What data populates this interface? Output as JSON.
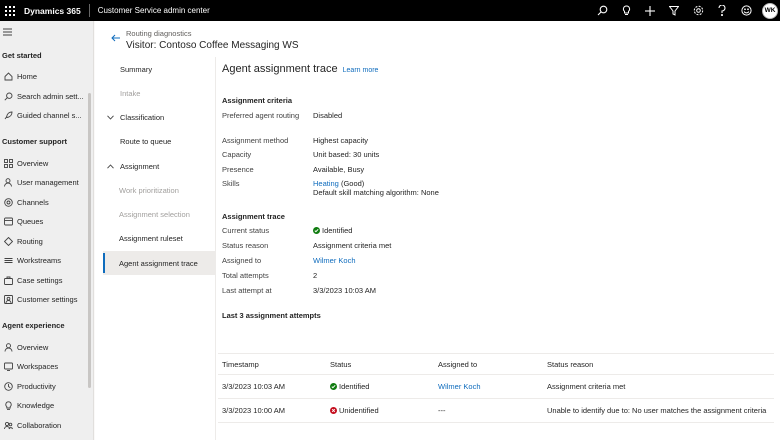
{
  "topbar": {
    "brand": "Dynamics 365",
    "app_name": "Customer Service admin center",
    "avatar_initials": "WK",
    "icons": [
      "search-icon",
      "lightbulb-icon",
      "plus-icon",
      "filter-icon",
      "gear-icon",
      "help-icon",
      "smiley-icon"
    ]
  },
  "leftnav": {
    "sections": [
      {
        "title": "Get started",
        "items": [
          {
            "label": "Home",
            "icon": "home-icon"
          },
          {
            "label": "Search admin sett...",
            "icon": "search-icon"
          },
          {
            "label": "Guided channel s...",
            "icon": "rocket-icon"
          }
        ]
      },
      {
        "title": "Customer support",
        "items": [
          {
            "label": "Overview",
            "icon": "grid-icon"
          },
          {
            "label": "User management",
            "icon": "user-icon"
          },
          {
            "label": "Channels",
            "icon": "channels-icon"
          },
          {
            "label": "Queues",
            "icon": "queue-icon"
          },
          {
            "label": "Routing",
            "icon": "routing-icon"
          },
          {
            "label": "Workstreams",
            "icon": "workstream-icon"
          },
          {
            "label": "Case settings",
            "icon": "case-icon"
          },
          {
            "label": "Customer settings",
            "icon": "customer-icon"
          }
        ]
      },
      {
        "title": "Agent experience",
        "items": [
          {
            "label": "Overview",
            "icon": "person-icon"
          },
          {
            "label": "Workspaces",
            "icon": "workspace-icon"
          },
          {
            "label": "Productivity",
            "icon": "productivity-icon"
          },
          {
            "label": "Knowledge",
            "icon": "knowledge-icon"
          },
          {
            "label": "Collaboration",
            "icon": "collaboration-icon"
          }
        ]
      }
    ]
  },
  "header": {
    "breadcrumb": "Routing diagnostics",
    "title": "Visitor: Contoso Coffee Messaging WS"
  },
  "steps": {
    "summary": "Summary",
    "intake": "Intake",
    "classification": "Classification",
    "route_to_queue": "Route to queue",
    "assignment": "Assignment",
    "work_prioritization": "Work prioritization",
    "assignment_selection": "Assignment selection",
    "assignment_ruleset": "Assignment ruleset",
    "agent_assignment_trace": "Agent assignment trace"
  },
  "content": {
    "title": "Agent assignment trace",
    "learn_more": "Learn more",
    "criteria": {
      "heading": "Assignment criteria",
      "preferred_label": "Preferred agent routing",
      "preferred_value": "Disabled",
      "method_label": "Assignment method",
      "method_value": "Highest capacity",
      "capacity_label": "Capacity",
      "capacity_value": "Unit based: 30 units",
      "presence_label": "Presence",
      "presence_value": "Available, Busy",
      "skills_label": "Skills",
      "skills_link": "Heating",
      "skills_level": " (Good)",
      "skills_algo": "Default skill matching algorithm: None"
    },
    "trace": {
      "heading": "Assignment trace",
      "status_label": "Current status",
      "status_value": "Identified",
      "reason_label": "Status reason",
      "reason_value": "Assignment criteria met",
      "assigned_label": "Assigned to",
      "assigned_value": "Wilmer Koch",
      "attempts_label": "Total attempts",
      "attempts_value": "2",
      "last_label": "Last attempt at",
      "last_value": "3/3/2023 10:03 AM"
    },
    "attempts": {
      "heading": "Last 3 assignment attempts",
      "columns": [
        "Timestamp",
        "Status",
        "Assigned to",
        "Status reason"
      ],
      "rows": [
        {
          "timestamp": "3/3/2023 10:03 AM",
          "status": "Identified",
          "assigned": "Wilmer Koch",
          "reason": "Assignment criteria met"
        },
        {
          "timestamp": "3/3/2023 10:00 AM",
          "status": "Unidentified",
          "assigned": "---",
          "reason": "Unable to identify due to: No user matches the assignment criteria"
        }
      ]
    }
  },
  "colors": {
    "accent": "#0f6cbd",
    "success": "#107c10",
    "error": "#c50f1f",
    "topbar": "#000000"
  }
}
